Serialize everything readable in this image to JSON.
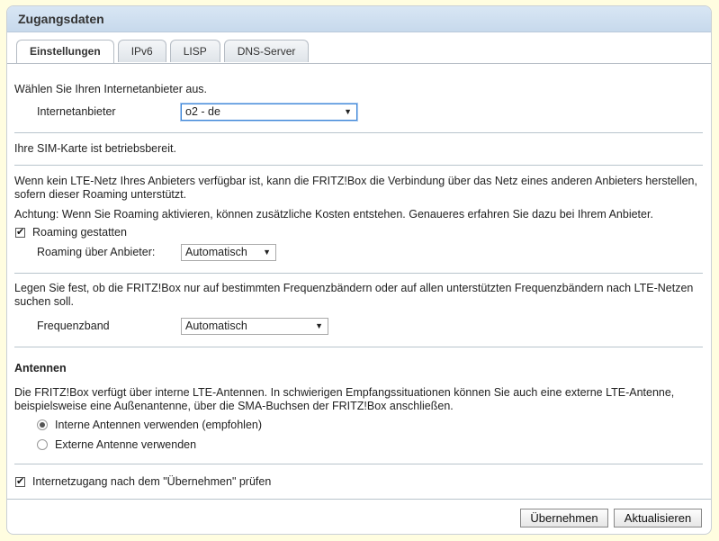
{
  "window": {
    "title": "Zugangsdaten"
  },
  "tabs": [
    {
      "label": "Einstellungen",
      "active": true
    },
    {
      "label": "IPv6"
    },
    {
      "label": "LISP"
    },
    {
      "label": "DNS-Server"
    }
  ],
  "provider": {
    "intro": "Wählen Sie Ihren Internetanbieter aus.",
    "label": "Internetanbieter",
    "value": "o2 - de"
  },
  "sim_status": "Ihre SIM-Karte ist betriebsbereit.",
  "roaming": {
    "info": "Wenn kein LTE-Netz Ihres Anbieters verfügbar ist, kann die FRITZ!Box die Verbindung über das Netz eines anderen Anbieters herstellen, sofern dieser Roaming unterstützt.",
    "warning": "Achtung: Wenn Sie Roaming aktivieren, können zusätzliche Kosten entstehen. Genaueres erfahren Sie dazu bei Ihrem Anbieter.",
    "allow_label": "Roaming gestatten",
    "allow_checked": true,
    "via_label": "Roaming über Anbieter:",
    "via_value": "Automatisch"
  },
  "frequency": {
    "info": "Legen Sie fest, ob die FRITZ!Box nur auf bestimmten Frequenzbändern oder auf allen unterstützten Frequenzbändern nach LTE-Netzen suchen soll.",
    "label": "Frequenzband",
    "value": "Automatisch"
  },
  "antennas": {
    "heading": "Antennen",
    "info": "Die FRITZ!Box verfügt über interne LTE-Antennen. In schwierigen Empfangssituationen können Sie auch eine externe LTE-Antenne, beispielsweise eine Außenantenne, über die SMA-Buchsen der FRITZ!Box anschließen.",
    "internal_label": "Interne Antennen verwenden (empfohlen)",
    "external_label": "Externe Antenne verwenden",
    "selected": "internal"
  },
  "check_internet": {
    "label": "Internetzugang nach dem \"Übernehmen\" prüfen",
    "checked": true
  },
  "buttons": {
    "apply": "Übernehmen",
    "refresh": "Aktualisieren"
  },
  "icons": {
    "dropdown": "triangle-down-icon",
    "check": "check-icon"
  }
}
